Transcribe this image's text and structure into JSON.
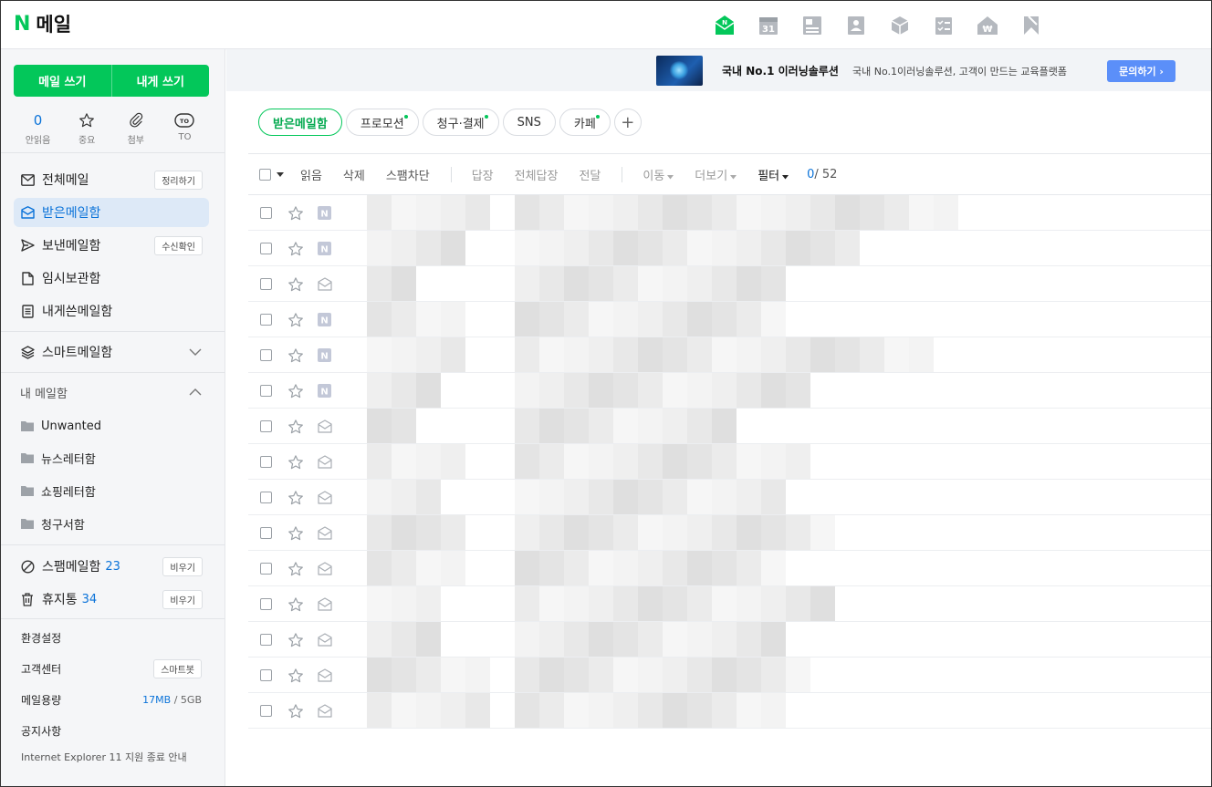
{
  "header": {
    "logo_mark": "N",
    "logo_text": "메일",
    "services": [
      "mail-icon",
      "calendar-icon",
      "memo-icon",
      "contacts-icon",
      "mybox-icon",
      "todo-icon",
      "pay-icon",
      "bookmark-icon"
    ],
    "calendar_number": "31",
    "pay_glyph": "₩"
  },
  "sidebar": {
    "write_mail": "메일 쓰기",
    "write_self": "내게 쓰기",
    "quick": [
      {
        "value": "0",
        "label": "안읽음"
      },
      {
        "label": "중요"
      },
      {
        "label": "첨부"
      },
      {
        "badge": "TO",
        "label": "TO"
      }
    ],
    "nav": [
      {
        "label": "전체메일",
        "chip": "정리하기"
      },
      {
        "label": "받은메일함",
        "active": true
      },
      {
        "label": "보낸메일함",
        "chip": "수신확인"
      },
      {
        "label": "임시보관함"
      },
      {
        "label": "내게쓴메일함"
      }
    ],
    "smart": "스마트메일함",
    "my_mailbox": "내 메일함",
    "folders": [
      "Unwanted",
      "뉴스레터함",
      "쇼핑레터함",
      "청구서함"
    ],
    "spam": {
      "label": "스팸메일함",
      "count": "23",
      "chip": "비우기"
    },
    "trash": {
      "label": "휴지통",
      "count": "34",
      "chip": "비우기"
    },
    "settings": "환경설정",
    "support": {
      "label": "고객센터",
      "chip": "스마트봇"
    },
    "usage": {
      "label": "메일용량",
      "used": "17MB",
      "sep": " / ",
      "total": "5GB"
    },
    "notice": "공지사항",
    "ie_notice": "Internet Explorer 11 지원 종료 안내"
  },
  "ad": {
    "title": "국내 No.1 이러닝솔루션",
    "subtitle": "국내 No.1이러닝솔루션, 고객이 만드는 교육플랫폼",
    "button": "문의하기 ›"
  },
  "tabs": [
    {
      "label": "받은메일함",
      "active": true,
      "dot": false
    },
    {
      "label": "프로모션",
      "dot": true
    },
    {
      "label": "청구·결제",
      "dot": true
    },
    {
      "label": "SNS",
      "dot": false
    },
    {
      "label": "카페",
      "dot": true
    }
  ],
  "tab_add": "+",
  "toolbar": {
    "read": "읽음",
    "delete": "삭제",
    "block_spam": "스팸차단",
    "reply": "답장",
    "reply_all": "전체답장",
    "forward": "전달",
    "move": "이동",
    "more": "더보기",
    "filter": "필터",
    "count_current": "0",
    "count_total": "/ 52"
  },
  "mail_rows": [
    {
      "type": "naver"
    },
    {
      "type": "naver"
    },
    {
      "type": "envelope"
    },
    {
      "type": "naver"
    },
    {
      "type": "naver"
    },
    {
      "type": "naver"
    },
    {
      "type": "envelope"
    },
    {
      "type": "envelope"
    },
    {
      "type": "envelope"
    },
    {
      "type": "envelope"
    },
    {
      "type": "envelope"
    },
    {
      "type": "envelope"
    },
    {
      "type": "envelope"
    },
    {
      "type": "envelope"
    },
    {
      "type": "envelope"
    }
  ],
  "colors": {
    "brand": "#03c75a",
    "accent": "#0b73d9",
    "active_bg": "#dde9f7",
    "ad_button": "#5b8ff9"
  }
}
